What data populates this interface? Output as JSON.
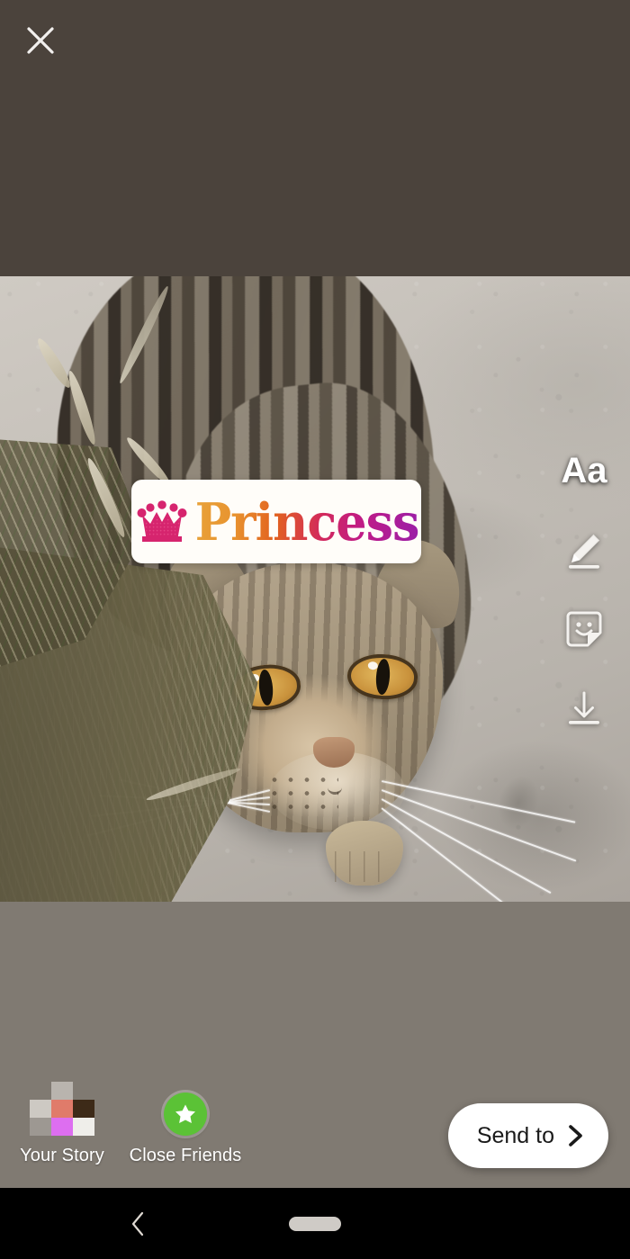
{
  "screen": {
    "app": "Instagram Story Editor",
    "letterbox_top_color": "#4b433c",
    "letterbox_bottom_color": "#807a72"
  },
  "topbar": {
    "close_icon": "close-icon",
    "close_label": "Close"
  },
  "canvas": {
    "photo_description": "Tabby cat lying on concrete beside dry grass, looking at camera",
    "sticker": {
      "type": "text-sticker",
      "icon": "crown-icon",
      "text": "Princess",
      "background_color": "#fffdf9",
      "crown_color": "#d6246e",
      "gradient_start": "#e8a23a",
      "gradient_end": "#9b1fa8"
    }
  },
  "tools": [
    {
      "name": "text-tool",
      "icon": "aa-icon",
      "label": "Aa"
    },
    {
      "name": "draw-tool",
      "icon": "pen-icon",
      "label": "Draw"
    },
    {
      "name": "sticker-tool",
      "icon": "sticker-icon",
      "label": "Stickers"
    },
    {
      "name": "save-tool",
      "icon": "download-icon",
      "label": "Save"
    }
  ],
  "bottom": {
    "your_story": {
      "label": "Your Story",
      "avatar": "pixelated-avatar",
      "mosaic_colors": [
        "#b9b4ae",
        "#d1cdc7",
        "#e07b6a",
        "#3d2a18",
        "#dd6ef0",
        "#efeeea",
        "#c9c5bf"
      ]
    },
    "close_friends": {
      "label": "Close Friends",
      "badge_icon": "star-icon",
      "badge_color": "#5bc236"
    },
    "send_to": {
      "label": "Send to",
      "icon": "chevron-right-icon",
      "background_color": "#ffffff",
      "text_color": "#1a1a1a"
    }
  },
  "navbar": {
    "back_icon": "chevron-left-icon",
    "home_icon": "home-pill-icon",
    "background_color": "#000000"
  }
}
